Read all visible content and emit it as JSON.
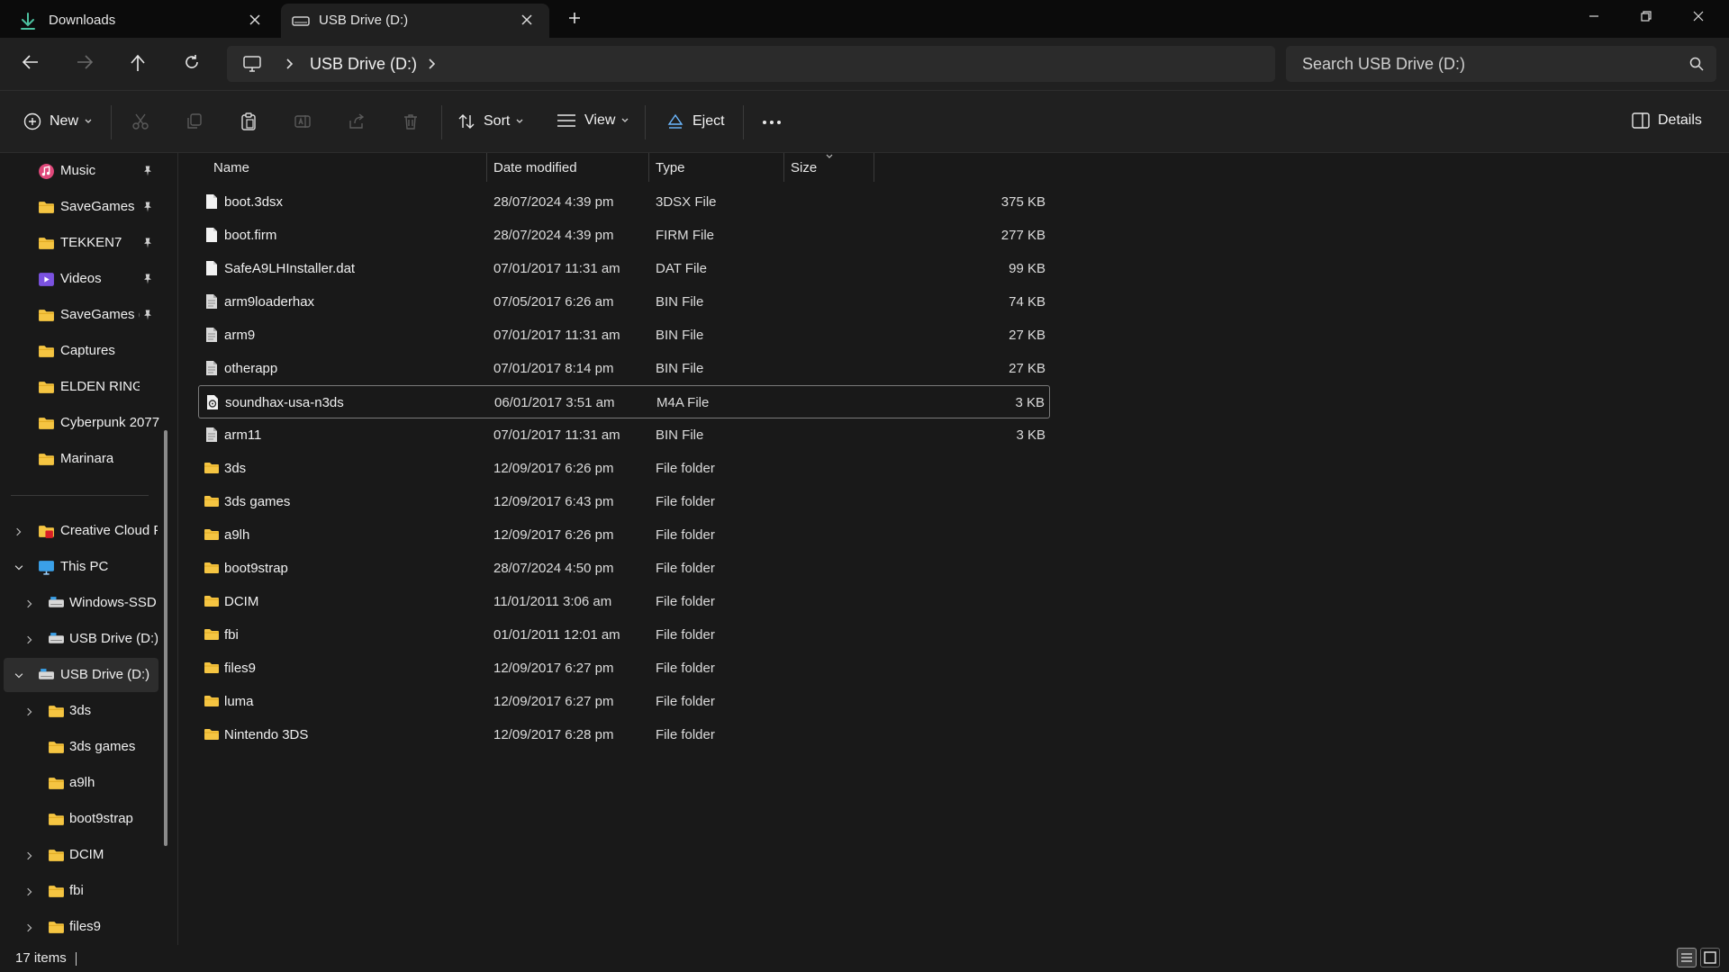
{
  "tabs": [
    {
      "label": "Downloads",
      "icon": "download-icon"
    },
    {
      "label": "USB Drive (D:)",
      "icon": "drive-icon"
    }
  ],
  "address": {
    "crumb": "USB Drive (D:)",
    "search_placeholder": "Search USB Drive (D:)"
  },
  "commands": {
    "new": "New",
    "sort": "Sort",
    "view": "View",
    "eject": "Eject",
    "details": "Details"
  },
  "columns": {
    "name": "Name",
    "date": "Date modified",
    "type": "Type",
    "size": "Size"
  },
  "sidebar": {
    "items": [
      {
        "label": "Music",
        "icon": "music-icon",
        "pinned": true
      },
      {
        "label": "SaveGames",
        "icon": "folder-icon",
        "pinned": true
      },
      {
        "label": "TEKKEN7",
        "icon": "folder-icon",
        "pinned": true
      },
      {
        "label": "Videos",
        "icon": "videos-icon",
        "pinned": true
      },
      {
        "label": "SaveGames (:",
        "icon": "folder-icon",
        "pinned": true
      },
      {
        "label": "Captures",
        "icon": "folder-icon",
        "pinned": false
      },
      {
        "label": "ELDEN RING™",
        "icon": "folder-icon",
        "pinned": false
      },
      {
        "label": "Cyberpunk 2077",
        "icon": "folder-icon",
        "pinned": false
      },
      {
        "label": "Marinara",
        "icon": "folder-icon",
        "pinned": false
      },
      {
        "label": "Creative Cloud F",
        "icon": "creative-cloud-icon",
        "pinned": false
      },
      {
        "label": "This PC",
        "icon": "pc-icon",
        "pinned": false
      },
      {
        "label": "Windows-SSD",
        "icon": "drive-icon",
        "pinned": false
      },
      {
        "label": "USB Drive (D:)",
        "icon": "drive-icon",
        "pinned": false
      },
      {
        "label": "USB Drive (D:)",
        "icon": "drive-icon",
        "pinned": false
      },
      {
        "label": "3ds",
        "icon": "folder-icon",
        "pinned": false
      },
      {
        "label": "3ds games",
        "icon": "folder-icon",
        "pinned": false
      },
      {
        "label": "a9lh",
        "icon": "folder-icon",
        "pinned": false
      },
      {
        "label": "boot9strap",
        "icon": "folder-icon",
        "pinned": false
      },
      {
        "label": "DCIM",
        "icon": "folder-icon",
        "pinned": false
      },
      {
        "label": "fbi",
        "icon": "folder-icon",
        "pinned": false
      },
      {
        "label": "files9",
        "icon": "folder-icon",
        "pinned": false
      }
    ]
  },
  "files": [
    {
      "name": "boot.3dsx",
      "date": "28/07/2024 4:39 pm",
      "type": "3DSX File",
      "size": "375 KB",
      "icon": "file-icon"
    },
    {
      "name": "boot.firm",
      "date": "28/07/2024 4:39 pm",
      "type": "FIRM File",
      "size": "277 KB",
      "icon": "file-icon"
    },
    {
      "name": "SafeA9LHInstaller.dat",
      "date": "07/01/2017 11:31 am",
      "type": "DAT File",
      "size": "99 KB",
      "icon": "file-icon"
    },
    {
      "name": "arm9loaderhax",
      "date": "07/05/2017 6:26 am",
      "type": "BIN File",
      "size": "74 KB",
      "icon": "bin-file-icon"
    },
    {
      "name": "arm9",
      "date": "07/01/2017 11:31 am",
      "type": "BIN File",
      "size": "27 KB",
      "icon": "bin-file-icon"
    },
    {
      "name": "otherapp",
      "date": "07/01/2017 8:14 pm",
      "type": "BIN File",
      "size": "27 KB",
      "icon": "bin-file-icon"
    },
    {
      "name": "soundhax-usa-n3ds",
      "date": "06/01/2017 3:51 am",
      "type": "M4A File",
      "size": "3 KB",
      "icon": "audio-file-icon"
    },
    {
      "name": "arm11",
      "date": "07/01/2017 11:31 am",
      "type": "BIN File",
      "size": "3 KB",
      "icon": "bin-file-icon"
    },
    {
      "name": "3ds",
      "date": "12/09/2017 6:26 pm",
      "type": "File folder",
      "size": "",
      "icon": "folder-icon"
    },
    {
      "name": "3ds games",
      "date": "12/09/2017 6:43 pm",
      "type": "File folder",
      "size": "",
      "icon": "folder-icon"
    },
    {
      "name": "a9lh",
      "date": "12/09/2017 6:26 pm",
      "type": "File folder",
      "size": "",
      "icon": "folder-icon"
    },
    {
      "name": "boot9strap",
      "date": "28/07/2024 4:50 pm",
      "type": "File folder",
      "size": "",
      "icon": "folder-icon"
    },
    {
      "name": "DCIM",
      "date": "11/01/2011 3:06 am",
      "type": "File folder",
      "size": "",
      "icon": "folder-icon"
    },
    {
      "name": "fbi",
      "date": "01/01/2011 12:01 am",
      "type": "File folder",
      "size": "",
      "icon": "folder-icon"
    },
    {
      "name": "files9",
      "date": "12/09/2017 6:27 pm",
      "type": "File folder",
      "size": "",
      "icon": "folder-icon"
    },
    {
      "name": "luma",
      "date": "12/09/2017 6:27 pm",
      "type": "File folder",
      "size": "",
      "icon": "folder-icon"
    },
    {
      "name": "Nintendo 3DS",
      "date": "12/09/2017 6:28 pm",
      "type": "File folder",
      "size": "",
      "icon": "folder-icon"
    }
  ],
  "status": {
    "count": "17 items"
  },
  "colors": {
    "background": "#191919",
    "chrome": "#202020",
    "folder": "#f5c542",
    "accent": "#4cc2ff"
  }
}
